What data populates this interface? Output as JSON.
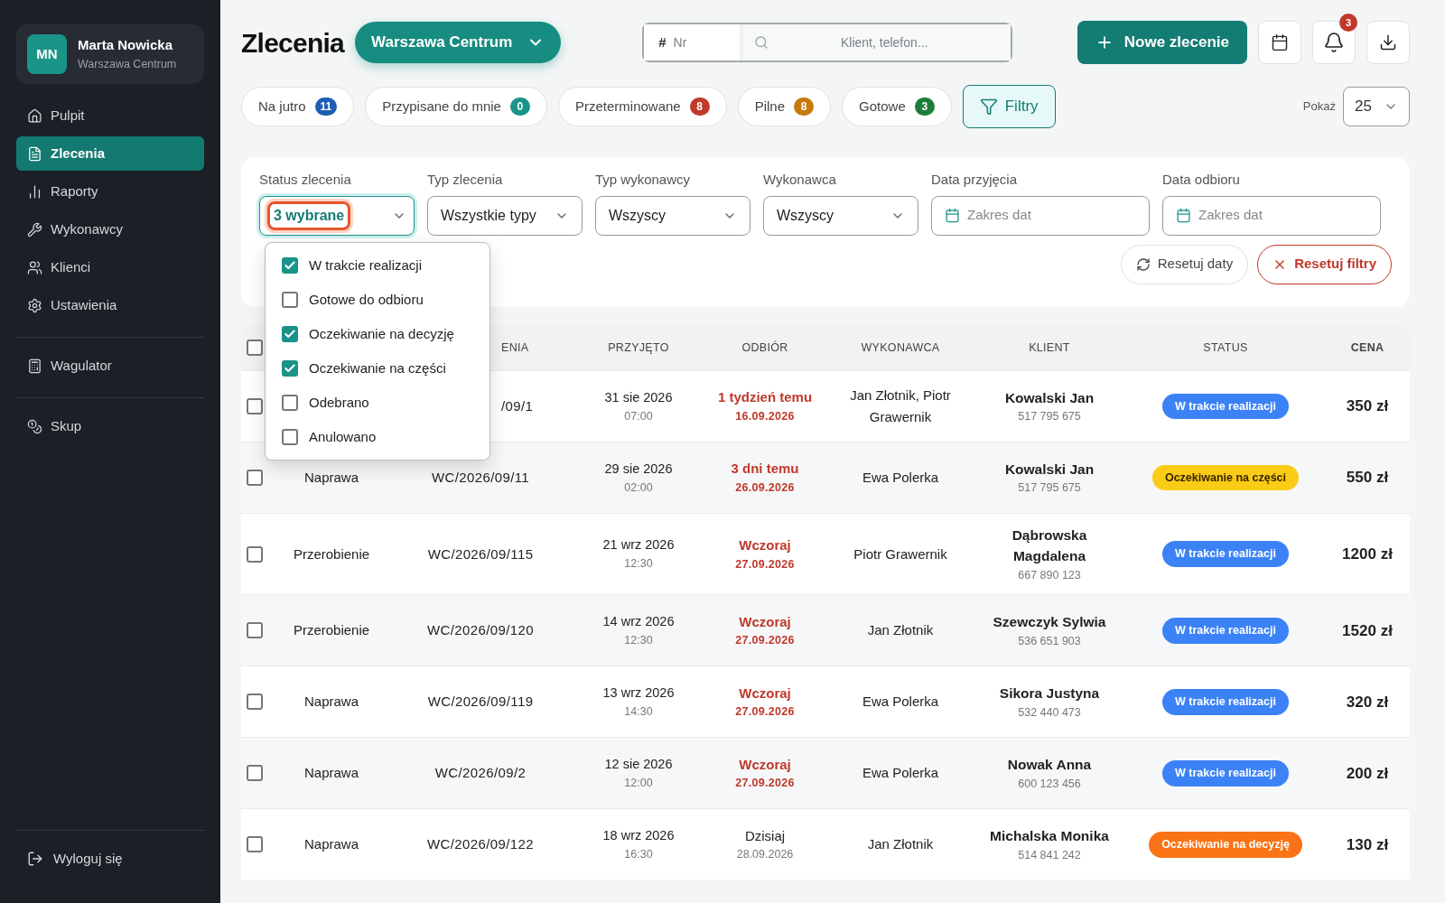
{
  "sidebar": {
    "user": {
      "initials": "MN",
      "name": "Marta Nowicka",
      "location": "Warszawa Centrum"
    },
    "groups": [
      [
        {
          "label": "Pulpit",
          "selected": false
        },
        {
          "label": "Zlecenia",
          "selected": true
        },
        {
          "label": "Raporty",
          "selected": false
        },
        {
          "label": "Wykonawcy",
          "selected": false
        },
        {
          "label": "Klienci",
          "selected": false
        },
        {
          "label": "Ustawienia",
          "selected": false
        }
      ],
      [
        {
          "label": "Wagulator",
          "selected": false
        }
      ],
      [
        {
          "label": "Skup",
          "selected": false
        }
      ]
    ],
    "logout": "Wyloguj się"
  },
  "header": {
    "title": "Zlecenia",
    "location": "Warszawa Centrum",
    "search": {
      "hash": "#",
      "number_placeholder": "Nr",
      "placeholder": "Klient, telefon..."
    },
    "new_button": "Nowe zlecenie",
    "notification_count": "3"
  },
  "quick_filters": [
    {
      "label": "Na jutro",
      "count": "11",
      "color": "#1e5fb4"
    },
    {
      "label": "Przypisane do mnie",
      "count": "0",
      "color": "#1a9488"
    },
    {
      "label": "Przeterminowane",
      "count": "8",
      "color": "#c0392b"
    },
    {
      "label": "Pilne",
      "count": "8",
      "color": "#c47a0c"
    },
    {
      "label": "Gotowe",
      "count": "3",
      "color": "#1e7d3c"
    }
  ],
  "filters_button": {
    "label": "Filtry",
    "selected": true
  },
  "page_size": {
    "label": "Pokaż",
    "value": "25"
  },
  "filters": [
    {
      "kind": "select",
      "label": "Status zlecenia",
      "value": "3 wybrane",
      "focused": true
    },
    {
      "kind": "select",
      "label": "Typ zlecenia",
      "value": "Wszystkie typy",
      "focused": false
    },
    {
      "kind": "select",
      "label": "Typ wykonawcy",
      "value": "Wszyscy",
      "focused": false
    },
    {
      "kind": "select",
      "label": "Wykonawca",
      "value": "Wszyscy",
      "focused": false
    },
    {
      "kind": "date",
      "label": "Data przyjęcia",
      "placeholder": "Zakres dat",
      "focused": false
    },
    {
      "kind": "date",
      "label": "Data odbioru",
      "placeholder": "Zakres dat",
      "focused": false
    }
  ],
  "status_options": [
    {
      "label": "W trakcie realizacji",
      "checked": true
    },
    {
      "label": "Gotowe do odbioru",
      "checked": false
    },
    {
      "label": "Oczekiwanie na decyzję",
      "checked": true
    },
    {
      "label": "Oczekiwanie na części",
      "checked": true
    },
    {
      "label": "Odebrano",
      "checked": false
    },
    {
      "label": "Anulowano",
      "checked": false
    }
  ],
  "reset_dates": "Resetuj daty",
  "reset_filters": "Resetuj filtry",
  "table": {
    "select_all": {
      "checked": false
    },
    "columns": [
      "ENIA",
      "PRZYJĘTO",
      "ODBIÓR",
      "WYKONAWCA",
      "KLIENT",
      "STATUS",
      "CENA"
    ],
    "rows": [
      {
        "checked": false,
        "number": "/09/1",
        "received": "31 sie 2026",
        "received_time": "07:00",
        "pickup": "1 tydzień temu",
        "pickup_date": "16.09.2026",
        "overdue": true,
        "contractor": "Jan Złotnik, Piotr Grawernik",
        "client": "Kowalski Jan",
        "phone": "517 795 675",
        "status": "W trakcie realizacji",
        "color": "#3b82f6",
        "price": "350 zł"
      },
      {
        "checked": false,
        "type": "Naprawa",
        "number": "WC/2026/09/11",
        "received": "29 sie 2026",
        "received_time": "02:00",
        "pickup": "3 dni temu",
        "pickup_date": "26.09.2026",
        "overdue": true,
        "contractor": "Ewa Polerka",
        "client": "Kowalski Jan",
        "phone": "517 795 675",
        "status": "Oczekiwanie na części",
        "color": "#facc15",
        "price": "550 zł"
      },
      {
        "checked": false,
        "type": "Przerobienie",
        "number": "WC/2026/09/115",
        "received": "21 wrz 2026",
        "received_time": "12:30",
        "pickup": "Wczoraj",
        "pickup_date": "27.09.2026",
        "overdue": true,
        "contractor": "Piotr Grawernik",
        "client": "Dąbrowska Magdalena",
        "phone": "667 890 123",
        "status": "W trakcie realizacji",
        "color": "#3b82f6",
        "price": "1200 zł"
      },
      {
        "checked": false,
        "type": "Przerobienie",
        "number": "WC/2026/09/120",
        "received": "14 wrz 2026",
        "received_time": "12:30",
        "pickup": "Wczoraj",
        "pickup_date": "27.09.2026",
        "overdue": true,
        "contractor": "Jan Złotnik",
        "client": "Szewczyk Sylwia",
        "phone": "536 651 903",
        "status": "W trakcie realizacji",
        "color": "#3b82f6",
        "price": "1520 zł"
      },
      {
        "checked": false,
        "type": "Naprawa",
        "number": "WC/2026/09/119",
        "received": "13 wrz 2026",
        "received_time": "14:30",
        "pickup": "Wczoraj",
        "pickup_date": "27.09.2026",
        "overdue": true,
        "contractor": "Ewa Polerka",
        "client": "Sikora Justyna",
        "phone": "532 440 473",
        "status": "W trakcie realizacji",
        "color": "#3b82f6",
        "price": "320 zł"
      },
      {
        "checked": false,
        "type": "Naprawa",
        "number": "WC/2026/09/2",
        "received": "12 sie 2026",
        "received_time": "12:00",
        "pickup": "Wczoraj",
        "pickup_date": "27.09.2026",
        "overdue": true,
        "contractor": "Ewa Polerka",
        "client": "Nowak Anna",
        "phone": "600 123 456",
        "status": "W trakcie realizacji",
        "color": "#3b82f6",
        "price": "200 zł"
      },
      {
        "checked": false,
        "type": "Naprawa",
        "number": "WC/2026/09/122",
        "received": "18 wrz 2026",
        "received_time": "16:30",
        "pickup": "Dzisiaj",
        "pickup_date": "28.09.2026",
        "overdue": false,
        "contractor": "Jan Złotnik",
        "client": "Michalska Monika",
        "phone": "514 841 242",
        "status": "Oczekiwanie na decyzję",
        "color": "#f97316",
        "price": "130 zł"
      }
    ]
  }
}
